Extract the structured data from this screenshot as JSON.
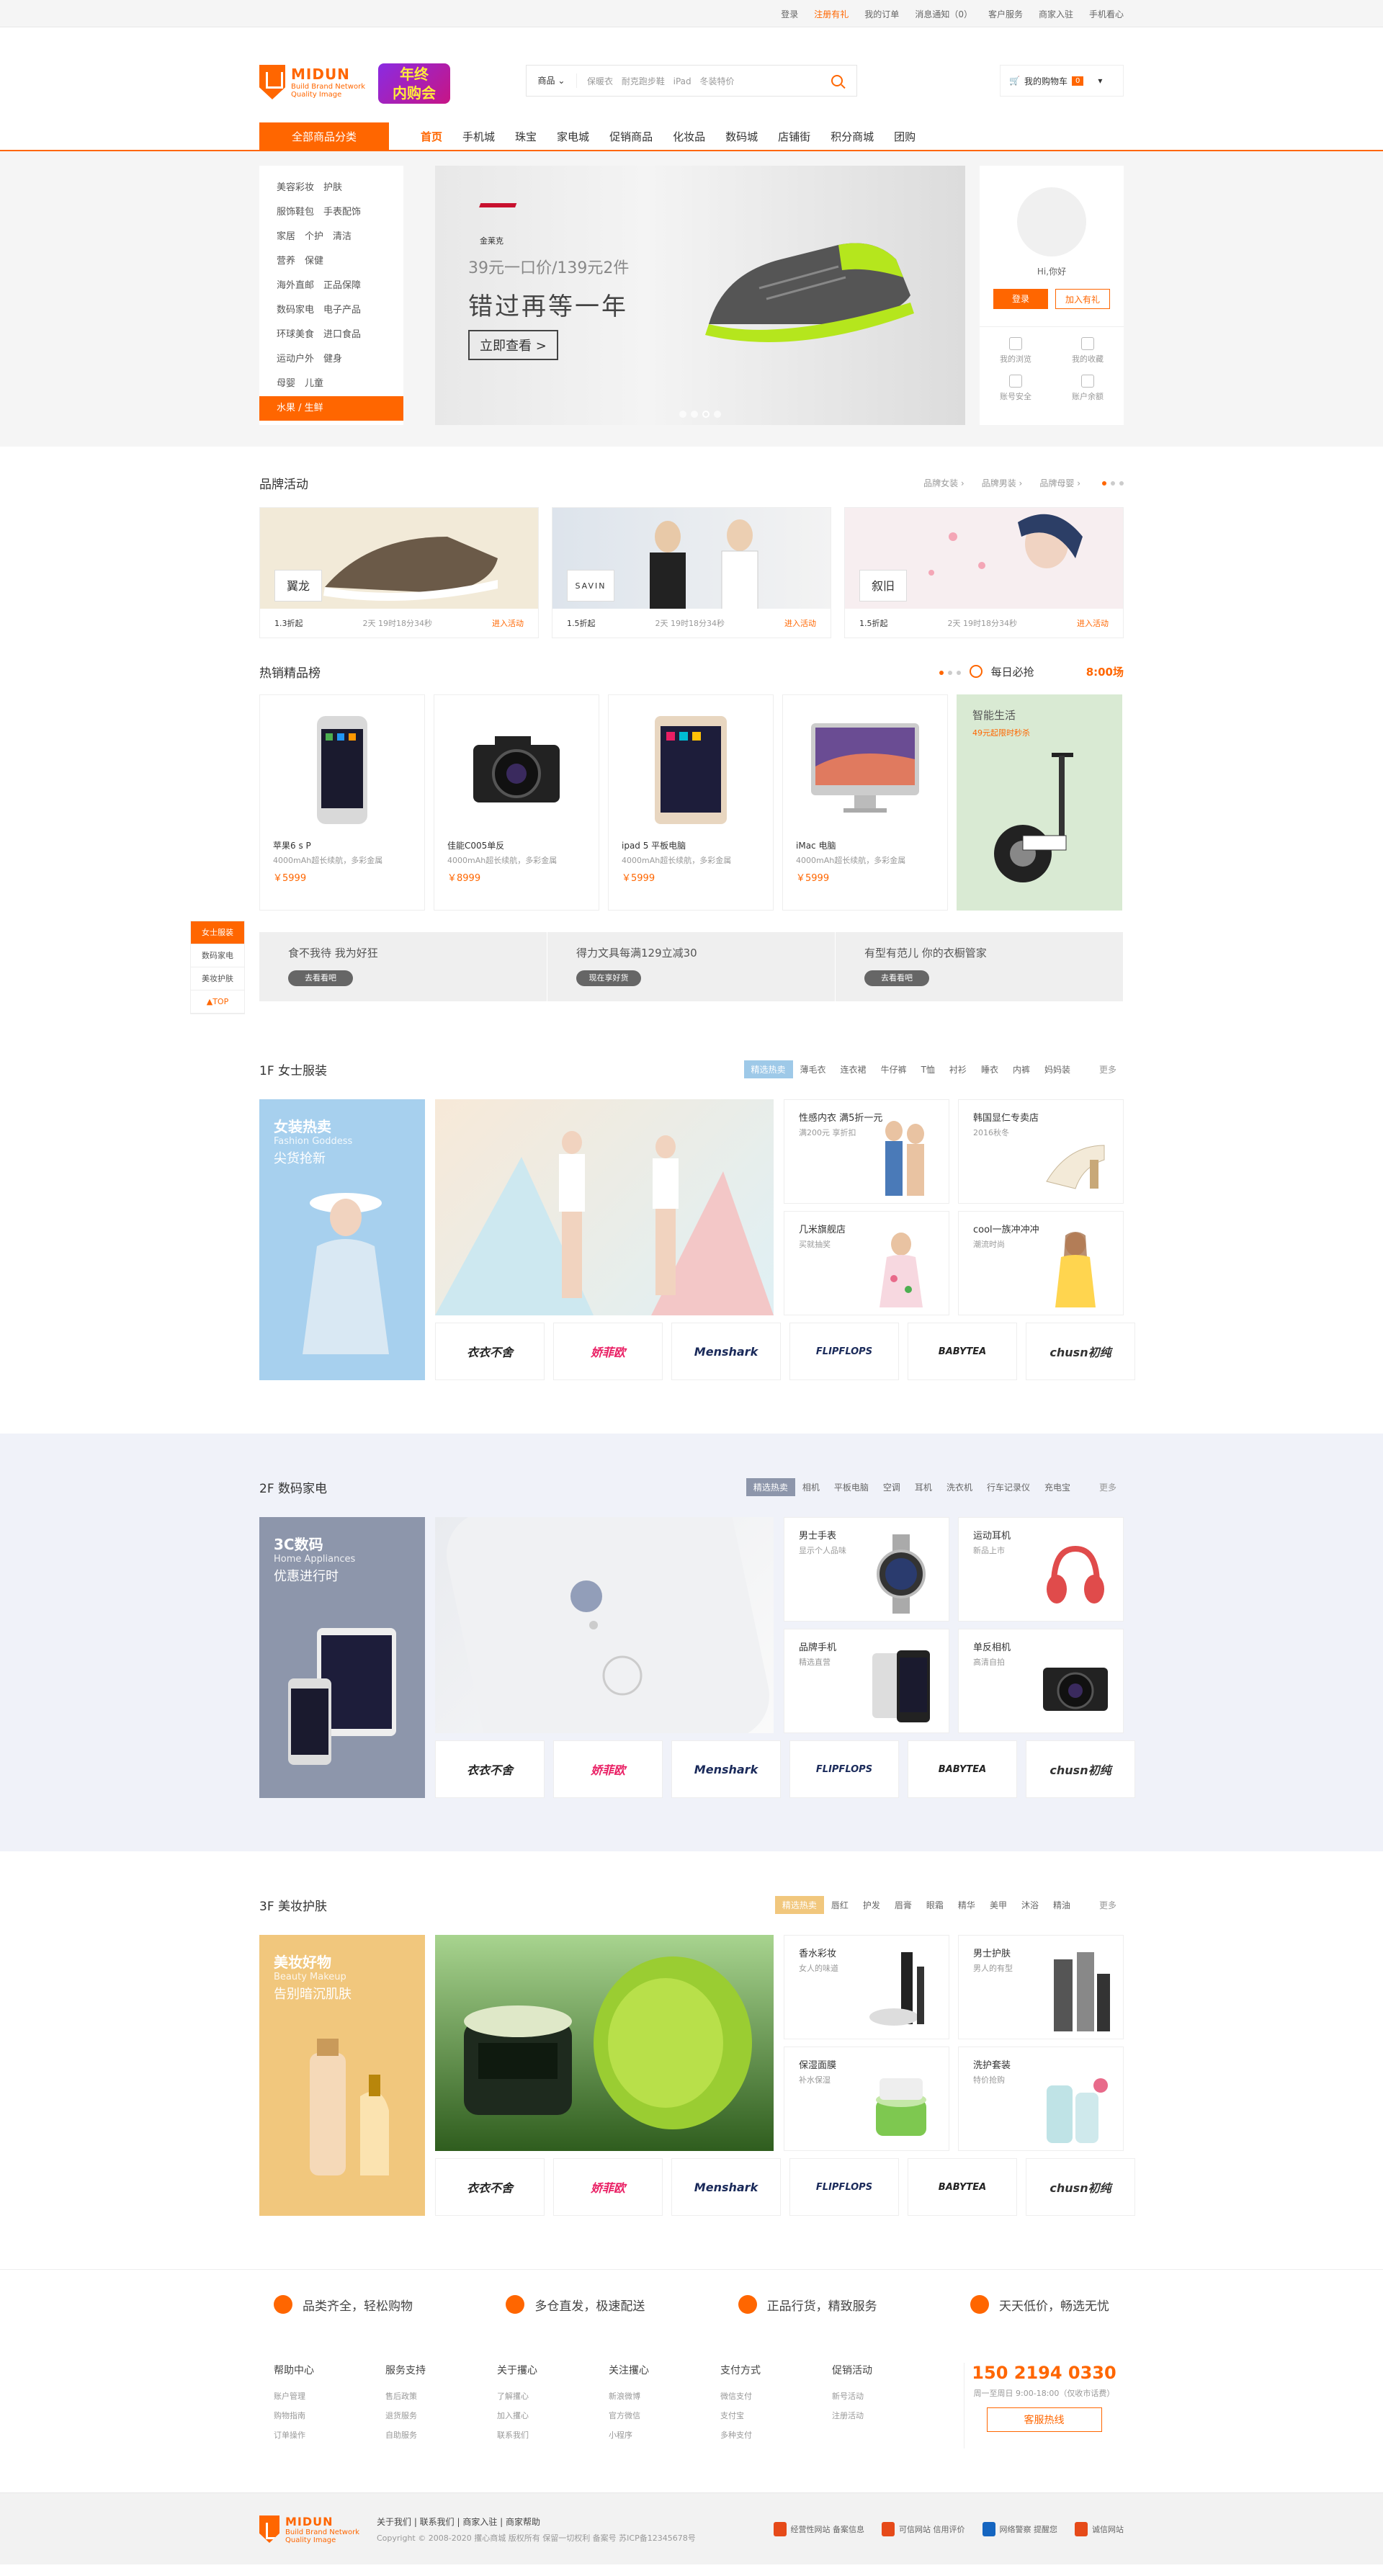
{
  "topbar": {
    "login": "登录",
    "register": "注册有礼",
    "orders": "我的订单",
    "messages": "消息通知（0）",
    "service": "客户服务",
    "merchant": "商家入驻",
    "mobile": "手机看心"
  },
  "header": {
    "logo_name": "MIDUN",
    "logo_sub1": "Build Brand Network",
    "logo_sub2": "Quality Image",
    "promo_line1": "年终",
    "promo_line2": "内购会",
    "search_category": "商品",
    "search_hot": "保暖衣 耐克跑步鞋 iPad 冬装特价",
    "cart_label": "我的购物车",
    "cart_count": "0"
  },
  "nav": {
    "all_categories": "全部商品分类",
    "links": [
      "首页",
      "手机城",
      "珠宝",
      "家电城",
      "促销商品",
      "化妆品",
      "数码城",
      "店铺街",
      "积分商城",
      "团购"
    ]
  },
  "categories": [
    "美容彩妆　护肤",
    "服饰鞋包　手表配饰",
    "家居　个护　清洁",
    "营养　保健",
    "海外直邮　正品保障",
    "数码家电　电子产品",
    "环球美食　进口食品",
    "运动户外　健身",
    "母婴　儿童",
    "水果 / 生鲜"
  ],
  "banner": {
    "brand": "金莱克",
    "price": "39元一口价/139元2件",
    "slogan": "错过再等一年",
    "cta": "立即查看 >"
  },
  "user": {
    "greeting": "Hi,你好",
    "login_btn": "登录",
    "join_btn": "加入有礼",
    "shortcuts": [
      "我的浏览",
      "我的收藏",
      "账号安全",
      "账户余额"
    ]
  },
  "brand_activity": {
    "title": "品牌活动",
    "filters": [
      "品牌女装",
      "品牌男装",
      "品牌母婴"
    ],
    "cards": [
      {
        "logo": "翼龙",
        "discount": "1.3折起",
        "time": "2天 19时18分34秒",
        "link": "进入活动"
      },
      {
        "logo": "SAVIN",
        "discount": "1.5折起",
        "time": "2天 19时18分34秒",
        "link": "进入活动"
      },
      {
        "logo": "叙旧",
        "discount": "1.5折起",
        "time": "2天 19时18分34秒",
        "link": "进入活动"
      }
    ]
  },
  "hot": {
    "title": "热销精品榜",
    "daily": "每日必抢",
    "daily_time": "8:00场",
    "products": [
      {
        "name": "苹果6 s P",
        "desc": "4000mAh超长续航，多彩金属",
        "price": "￥5999"
      },
      {
        "name": "佳能C005单反",
        "desc": "4000mAh超长续航，多彩金属",
        "price": "￥8999"
      },
      {
        "name": "ipad 5 平板电脑",
        "desc": "4000mAh超长续航，多彩金属",
        "price": "￥5999"
      },
      {
        "name": "iMac 电脑",
        "desc": "4000mAh超长续航，多彩金属",
        "price": "￥5999"
      }
    ],
    "smart_title": "智能生活",
    "smart_sub": "49元起限时秒杀"
  },
  "strip": [
    {
      "text": "食不我待 我为好狂",
      "btn": "去看看吧"
    },
    {
      "text": "得力文具每满129立减30",
      "btn": "现在享好货"
    },
    {
      "text": "有型有范儿 你的衣橱管家",
      "btn": "去看看吧"
    }
  ],
  "sidenav": [
    "女士服装",
    "数码家电",
    "美妆护肤",
    "▲TOP"
  ],
  "floor1": {
    "title": "1F 女士服装",
    "tabs": [
      "精选热卖",
      "薄毛衣",
      "连衣裙",
      "牛仔裤",
      "T恤",
      "衬衫",
      "睡衣",
      "内裤",
      "妈妈装"
    ],
    "more": "更多",
    "left1": "女装热卖",
    "left2": "Fashion Goddess",
    "left3": "尖货抢新",
    "cards": [
      {
        "t": "性感内衣 满5折一元",
        "s": "满200元 享折扣"
      },
      {
        "t": "韩国显仁专卖店",
        "s": "2016秋冬"
      },
      {
        "t": "几米旗舰店",
        "s": "买就抽奖"
      },
      {
        "t": "cool一族冲冲冲",
        "s": "潮流时尚"
      }
    ]
  },
  "floor2": {
    "title": "2F 数码家电",
    "tabs": [
      "精选热卖",
      "相机",
      "平板电脑",
      "空调",
      "耳机",
      "洗衣机",
      "行车记录仪",
      "充电宝"
    ],
    "more": "更多",
    "left1": "3C数码",
    "left2": "Home Appliances",
    "left3": "优惠进行时",
    "cards": [
      {
        "t": "男士手表",
        "s": "显示个人品味"
      },
      {
        "t": "运动耳机",
        "s": "新品上市"
      },
      {
        "t": "品牌手机",
        "s": "精选直营"
      },
      {
        "t": "单反相机",
        "s": "高清自拍"
      }
    ]
  },
  "floor3": {
    "title": "3F 美妆护肤",
    "tabs": [
      "精选热卖",
      "唇红",
      "护发",
      "眉膏",
      "眼霜",
      "精华",
      "美甲",
      "沐浴",
      "精油"
    ],
    "more": "更多",
    "left1": "美妆好物",
    "left2": "Beauty Makeup",
    "left3": "告别暗沉肌肤",
    "cards": [
      {
        "t": "香水彩妆",
        "s": "女人的味道"
      },
      {
        "t": "男士护肤",
        "s": "男人的有型"
      },
      {
        "t": "保湿面膜",
        "s": "补水保湿"
      },
      {
        "t": "洗护套装",
        "s": "特价抢购"
      }
    ]
  },
  "brand_logos": [
    "衣衣不舍",
    "娇菲欧",
    "Menshark",
    "FLIPFLOPS",
    "BABYTEA",
    "chusn初纯"
  ],
  "services": [
    "品类齐全，轻松购物",
    "多仓直发，极速配送",
    "正品行货，精致服务",
    "天天低价，畅选无忧"
  ],
  "footer_cols": [
    {
      "h": "帮助中心",
      "items": [
        "账户管理",
        "购物指南",
        "订单操作"
      ]
    },
    {
      "h": "服务支持",
      "items": [
        "售后政策",
        "退货服务",
        "自助服务"
      ]
    },
    {
      "h": "关于攫心",
      "items": [
        "了解攫心",
        "加入攫心",
        "联系我们"
      ]
    },
    {
      "h": "关注攫心",
      "items": [
        "新浪微博",
        "官方微信",
        "小程序"
      ]
    },
    {
      "h": "支付方式",
      "items": [
        "微信支付",
        "支付宝",
        "多种支付"
      ]
    },
    {
      "h": "促销活动",
      "items": [
        "新号活动",
        "注册活动"
      ]
    }
  ],
  "hotline": {
    "number": "150 2194 0330",
    "sub": "周一至周日 9:00-18:00（仅收市话费）",
    "btn": "客服热线"
  },
  "bottom": {
    "links": "关于我们 | 联系我们 | 商家入驻 | 商家帮助",
    "copy": "Copyright © 2008-2020 攫心商城 版权所有 保留一切权利 备案号 苏ICP备12345678号",
    "badges": [
      "经营性网站 备案信息",
      "可信网站 信用评价",
      "网络警察 提醒您",
      "诚信网站"
    ]
  }
}
